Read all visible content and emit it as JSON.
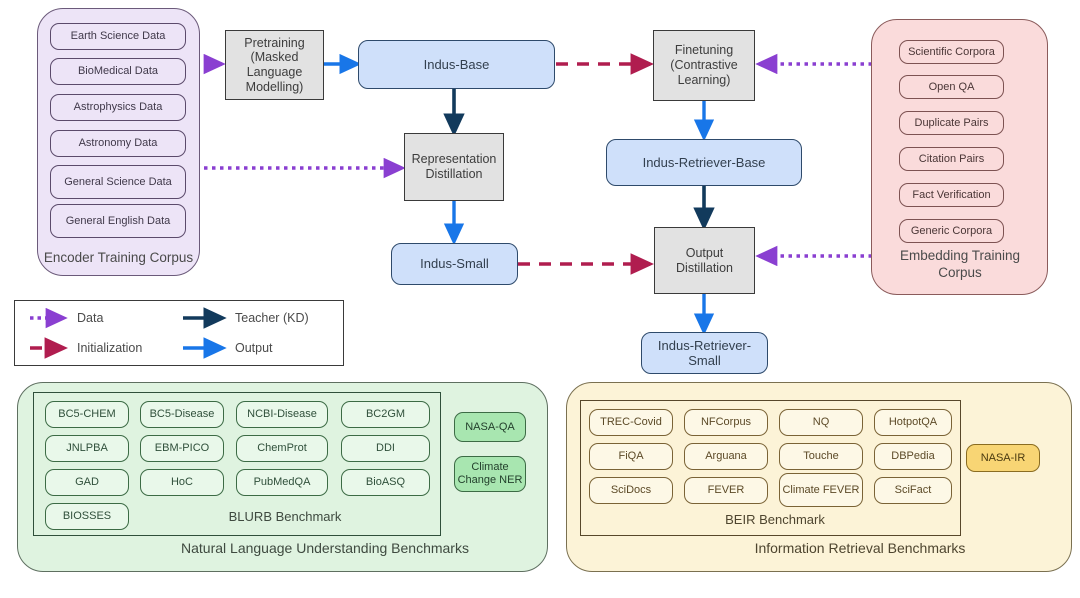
{
  "encoder_corpus": {
    "caption": "Encoder Training Corpus",
    "items": [
      "Earth Science  Data",
      "BioMedical Data",
      "Astrophysics  Data",
      "Astronomy   Data",
      "General Science Data",
      "General English Data"
    ]
  },
  "embedding_corpus": {
    "caption": "Embedding Training Corpus",
    "items": [
      "Scientific Corpora",
      "Open QA",
      "Duplicate Pairs",
      "Citation Pairs",
      "Fact Verification",
      "Generic Corpora"
    ]
  },
  "pipeline": {
    "pretraining": "Pretraining (Masked Language Modelling)",
    "indus_base": "Indus-Base",
    "representation_distillation": "Representation Distillation",
    "indus_small": "Indus-Small",
    "finetuning": "Finetuning (Contrastive Learning)",
    "indus_retriever_base": "Indus-Retriever-Base",
    "output_distillation": "Output Distillation",
    "indus_retriever_small": "Indus-Retriever-Small"
  },
  "legend": {
    "items": [
      {
        "label": "Data",
        "style": "dotted",
        "color": "#8a3fd1"
      },
      {
        "label": "Initialization",
        "style": "dashed",
        "color": "#b01d4f"
      },
      {
        "label": "Teacher (KD)",
        "style": "solid",
        "color": "#123a5c"
      },
      {
        "label": "Output",
        "style": "solid",
        "color": "#1876e8"
      }
    ]
  },
  "nlu_benchmarks": {
    "caption": "Natural Language Understanding Benchmarks",
    "inner_label": "BLURB Benchmark",
    "columns": [
      [
        "BC5-CHEM",
        "JNLPBA",
        "GAD",
        "BIOSSES"
      ],
      [
        "BC5-Disease",
        "EBM-PICO",
        "HoC"
      ],
      [
        "NCBI-Disease",
        "ChemProt",
        "PubMedQA"
      ],
      [
        "BC2GM",
        "DDI",
        "BioASQ"
      ]
    ],
    "extras": [
      "NASA-QA",
      "Climate Change NER"
    ]
  },
  "ir_benchmarks": {
    "caption": "Information Retrieval Benchmarks",
    "inner_label": "BEIR Benchmark",
    "columns": [
      [
        "TREC-Covid",
        "FiQA",
        "SciDocs"
      ],
      [
        "NFCorpus",
        "Arguana",
        "FEVER"
      ],
      [
        "NQ",
        "Touche",
        "Climate FEVER"
      ],
      [
        "HotpotQA",
        "DBPedia",
        "SciFact"
      ]
    ],
    "extras": [
      "NASA-IR"
    ]
  },
  "colors": {
    "data_arrow": "#8a3fd1",
    "init_arrow": "#b01d4f",
    "teacher_arrow": "#123a5c",
    "output_arrow": "#1876e8",
    "encoder_panel": "#ede4f7",
    "embedding_panel": "#fadbdb",
    "nlu_panel": "#dff3e0",
    "ir_panel": "#fcf3d7",
    "model_node": "#cfe0fa",
    "process_node": "#e2e2e2"
  }
}
